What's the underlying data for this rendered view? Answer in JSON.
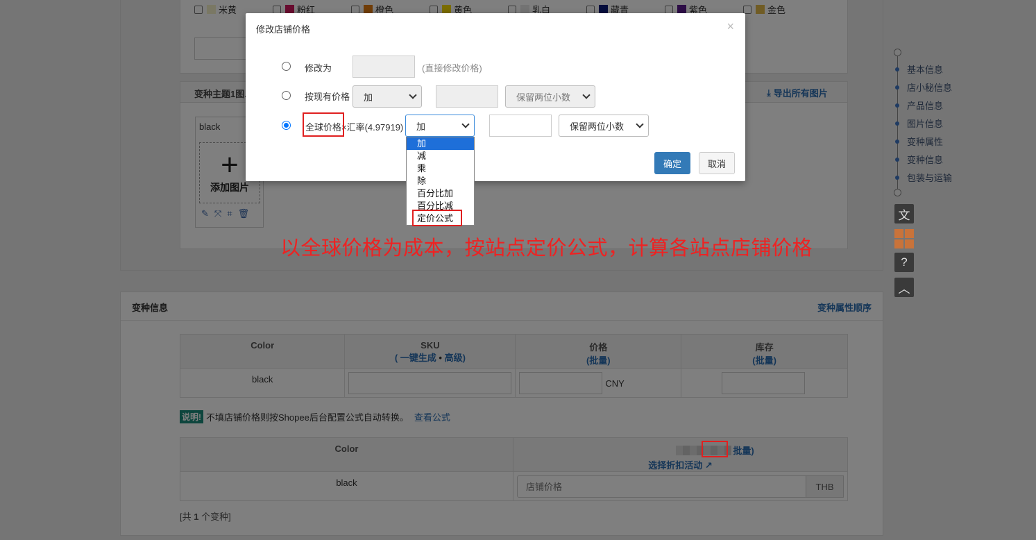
{
  "colors": [
    {
      "label": "米黄",
      "hex": "#f5f0c8"
    },
    {
      "label": "粉红",
      "hex": "#d0185f"
    },
    {
      "label": "橙色",
      "hex": "#e07b10"
    },
    {
      "label": "黄色",
      "hex": "#f5d800"
    },
    {
      "label": "乳白",
      "hex": "#e6e6e6"
    },
    {
      "label": "藏青",
      "hex": "#0a1a78"
    },
    {
      "label": "紫色",
      "hex": "#5a1a8c"
    },
    {
      "label": "金色",
      "hex": "#e0b84a"
    }
  ],
  "variant_image_section": {
    "title": "变种主题1图...",
    "export_all": "导出所有图片",
    "variant_label": "black",
    "add_image": "添加图片"
  },
  "variant_info": {
    "title": "变种信息",
    "attr_order_link": "变种属性顺序",
    "table1": {
      "headers": {
        "color": "Color",
        "sku": "SKU",
        "sku_paren_open": "(",
        "sku_generate": "一键生成",
        "sku_dot": "•",
        "sku_advanced": "高级",
        "sku_paren_close": ")",
        "price": "价格",
        "price_batch": "(批量)",
        "stock": "库存",
        "stock_batch": "(批量)"
      },
      "row": {
        "color": "black",
        "currency": "CNY"
      }
    },
    "note_badge": "说明!",
    "note_text": "不填店铺价格则按Shopee后台配置公式自动转换。",
    "note_link": "查看公式",
    "table2": {
      "headers": {
        "color": "Color",
        "batch": "批量)",
        "choose_discount": "选择折扣活动"
      },
      "row": {
        "color": "black",
        "price_placeholder": "店铺价格",
        "currency": "THB"
      }
    },
    "count_prefix": "[共",
    "count_value": "1",
    "count_suffix": "个变种]"
  },
  "right_nav": {
    "items": [
      "基本信息",
      "店小秘信息",
      "产品信息",
      "图片信息",
      "变种属性",
      "变种信息",
      "包装与运输"
    ]
  },
  "modal": {
    "title": "修改店铺价格",
    "close": "×",
    "option1_label": "修改为",
    "option1_hint": "(直接修改价格)",
    "option2_label": "按现有价格",
    "option2_op": "加",
    "option2_rounding": "保留两位小数",
    "option3_label_a": "全球价格",
    "option3_label_b": "×汇率(4.97919)",
    "option3_op": "加",
    "option3_rounding": "保留两位小数",
    "selected_option": 3,
    "confirm": "确定",
    "cancel": "取消"
  },
  "dropdown_options": [
    "加",
    "减",
    "乘",
    "除",
    "百分比加",
    "百分比减",
    "定价公式"
  ],
  "dropdown_selected_index": 0,
  "annotation": "以全球价格为成本，按站点定价公式，计算各站点店铺价格"
}
